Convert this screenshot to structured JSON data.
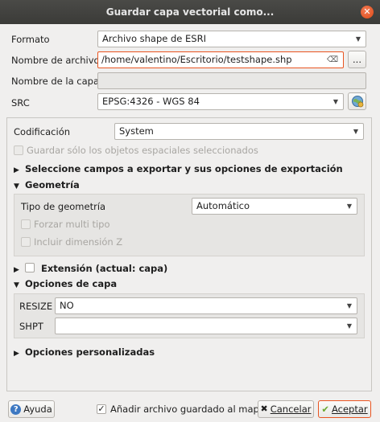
{
  "window": {
    "title": "Guardar capa vectorial como...",
    "close_icon": "close-icon"
  },
  "form": {
    "format_label": "Formato",
    "format_value": "Archivo shape de ESRI",
    "filename_label": "Nombre de archivo",
    "filename_value": "/home/valentino/Escritorio/testshape.shp",
    "browse_label": "...",
    "layername_label": "Nombre de la capa",
    "layername_value": "",
    "src_label": "SRC",
    "src_value": "EPSG:4326 - WGS 84"
  },
  "panel": {
    "encoding_label": "Codificación",
    "encoding_value": "System",
    "save_selected_label": "Guardar sólo los objetos espaciales seleccionados",
    "fields_section": "Seleccione campos a exportar y sus opciones de exportación",
    "geometry_section": "Geometría",
    "geometry_type_label": "Tipo de geometría",
    "geometry_type_value": "Automático",
    "force_multi_label": "Forzar multi tipo",
    "include_z_label": "Incluir dimensión Z",
    "extent_section": "Extensión (actual: capa)",
    "layer_options_section": "Opciones de capa",
    "resize_label": "RESIZE",
    "resize_value": "NO",
    "shpt_label": "SHPT",
    "shpt_value": "",
    "custom_options_section": "Opciones personalizadas"
  },
  "footer": {
    "help_label": "Ayuda",
    "add_to_map_label": "Añadir archivo guardado al mapa",
    "add_to_map_checked": true,
    "cancel_label": "Cancelar",
    "accept_label": "Aceptar"
  },
  "colors": {
    "accent": "#e95420",
    "titlebar": "#3f3f3c"
  }
}
